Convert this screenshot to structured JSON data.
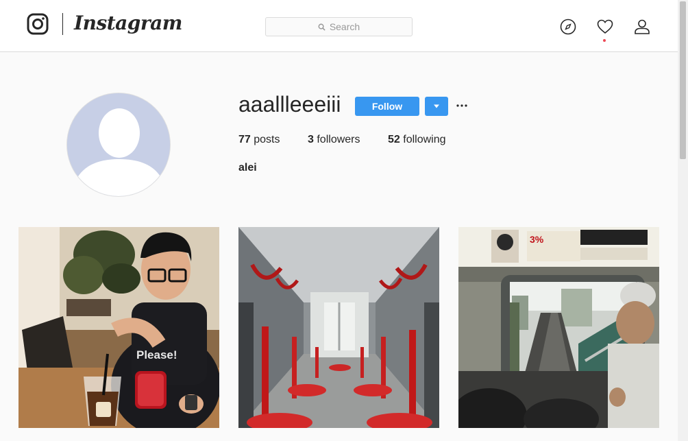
{
  "header": {
    "logo_text": "Instagram",
    "search_placeholder": "Search",
    "icons": [
      "instagram-glyph-icon",
      "explore-compass-icon",
      "heart-icon",
      "profile-icon"
    ],
    "notification_dot_color": "#ed4956"
  },
  "profile": {
    "username": "aaallleeeiii",
    "follow_label": "Follow",
    "posts_count": "77",
    "posts_label": "posts",
    "followers_count": "3",
    "followers_label": "followers",
    "following_count": "52",
    "following_label": "following",
    "full_name": "alei"
  },
  "colors": {
    "accent": "#3897f0",
    "avatar_bg": "#c7cfe6",
    "border": "#dbdbdb",
    "background": "#fafafa"
  },
  "posts": [
    {
      "subject": "man-with-phone-and-coffee-photo"
    },
    {
      "subject": "subway-car-interior-photo"
    },
    {
      "subject": "train-window-street-view-photo"
    }
  ]
}
